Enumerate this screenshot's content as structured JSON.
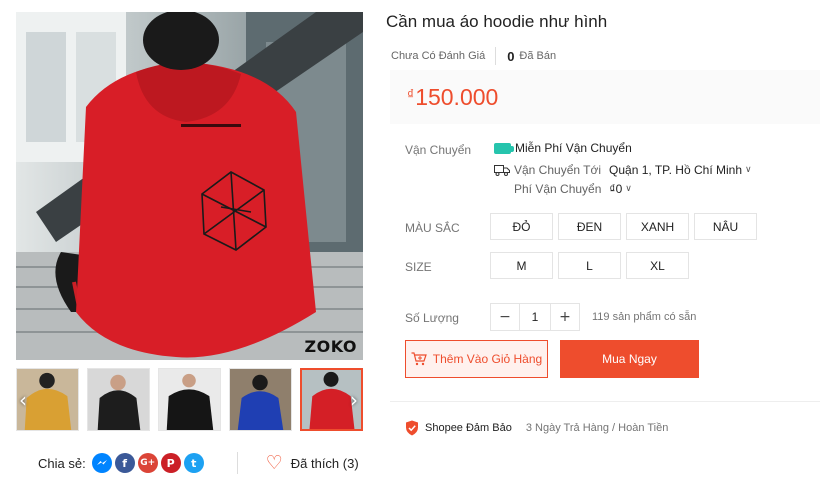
{
  "product": {
    "title": "Cần mua áo hoodie như hình",
    "rating_text": "Chưa Có Đánh Giá",
    "sold_count": "0",
    "sold_label": "Đã Bán",
    "currency_symbol": "₫",
    "price": "150.000",
    "brand_mark": "ZOKO"
  },
  "shipping": {
    "label": "Vận Chuyển",
    "free_shipping": "Miễn Phí Vận Chuyển",
    "ship_to_label": "Vận Chuyển Tới",
    "ship_to_value": "Quận 1, TP. Hồ Chí Minh",
    "fee_label": "Phí Vận Chuyển",
    "fee_value": "₫0"
  },
  "variations": {
    "color_label": "MÀU SẮC",
    "colors": [
      "ĐỎ",
      "ĐEN",
      "XANH",
      "NÂU"
    ],
    "size_label": "SIZE",
    "sizes": [
      "M",
      "L",
      "XL"
    ]
  },
  "quantity": {
    "label": "Số Lượng",
    "minus": "−",
    "value": "1",
    "plus": "+",
    "stock_text": "119 sản phẩm có sẵn"
  },
  "actions": {
    "add_to_cart": "Thêm Vào Giỏ Hàng",
    "buy_now": "Mua Ngay"
  },
  "guarantee": {
    "title": "Shopee Đảm Bảo",
    "subtitle": "3 Ngày Trả Hàng / Hoàn Tiền"
  },
  "gallery": {
    "prev_arrow": "‹",
    "next_arrow": "›",
    "thumbnails": [
      {
        "hoodie_color": "#d9a033",
        "bg": "#c9b79a"
      },
      {
        "hoodie_color": "#1d1d1d",
        "bg": "#d8d8d8"
      },
      {
        "hoodie_color": "#151515",
        "bg": "#eaeaea"
      },
      {
        "hoodie_color": "#1f3fb3",
        "bg": "#8f7f6c"
      },
      {
        "hoodie_color": "#d41f26",
        "bg": "#b6c0c2"
      }
    ]
  },
  "social": {
    "share_label": "Chia sẻ:",
    "icons": [
      {
        "name": "messenger-icon",
        "glyph": "~",
        "color": "#0084ff"
      },
      {
        "name": "facebook-icon",
        "glyph": "f",
        "color": "#3b5998"
      },
      {
        "name": "google-plus-icon",
        "glyph": "G+",
        "color": "#db4437"
      },
      {
        "name": "pinterest-icon",
        "glyph": "P",
        "color": "#cb2027"
      },
      {
        "name": "twitter-icon",
        "glyph": "t",
        "color": "#1da1f2"
      }
    ],
    "liked_text": "Đã thích (3)"
  },
  "colors": {
    "accent": "#ee4d2d",
    "price_bg": "#fafafa",
    "free_ship": "#26c4ad"
  }
}
